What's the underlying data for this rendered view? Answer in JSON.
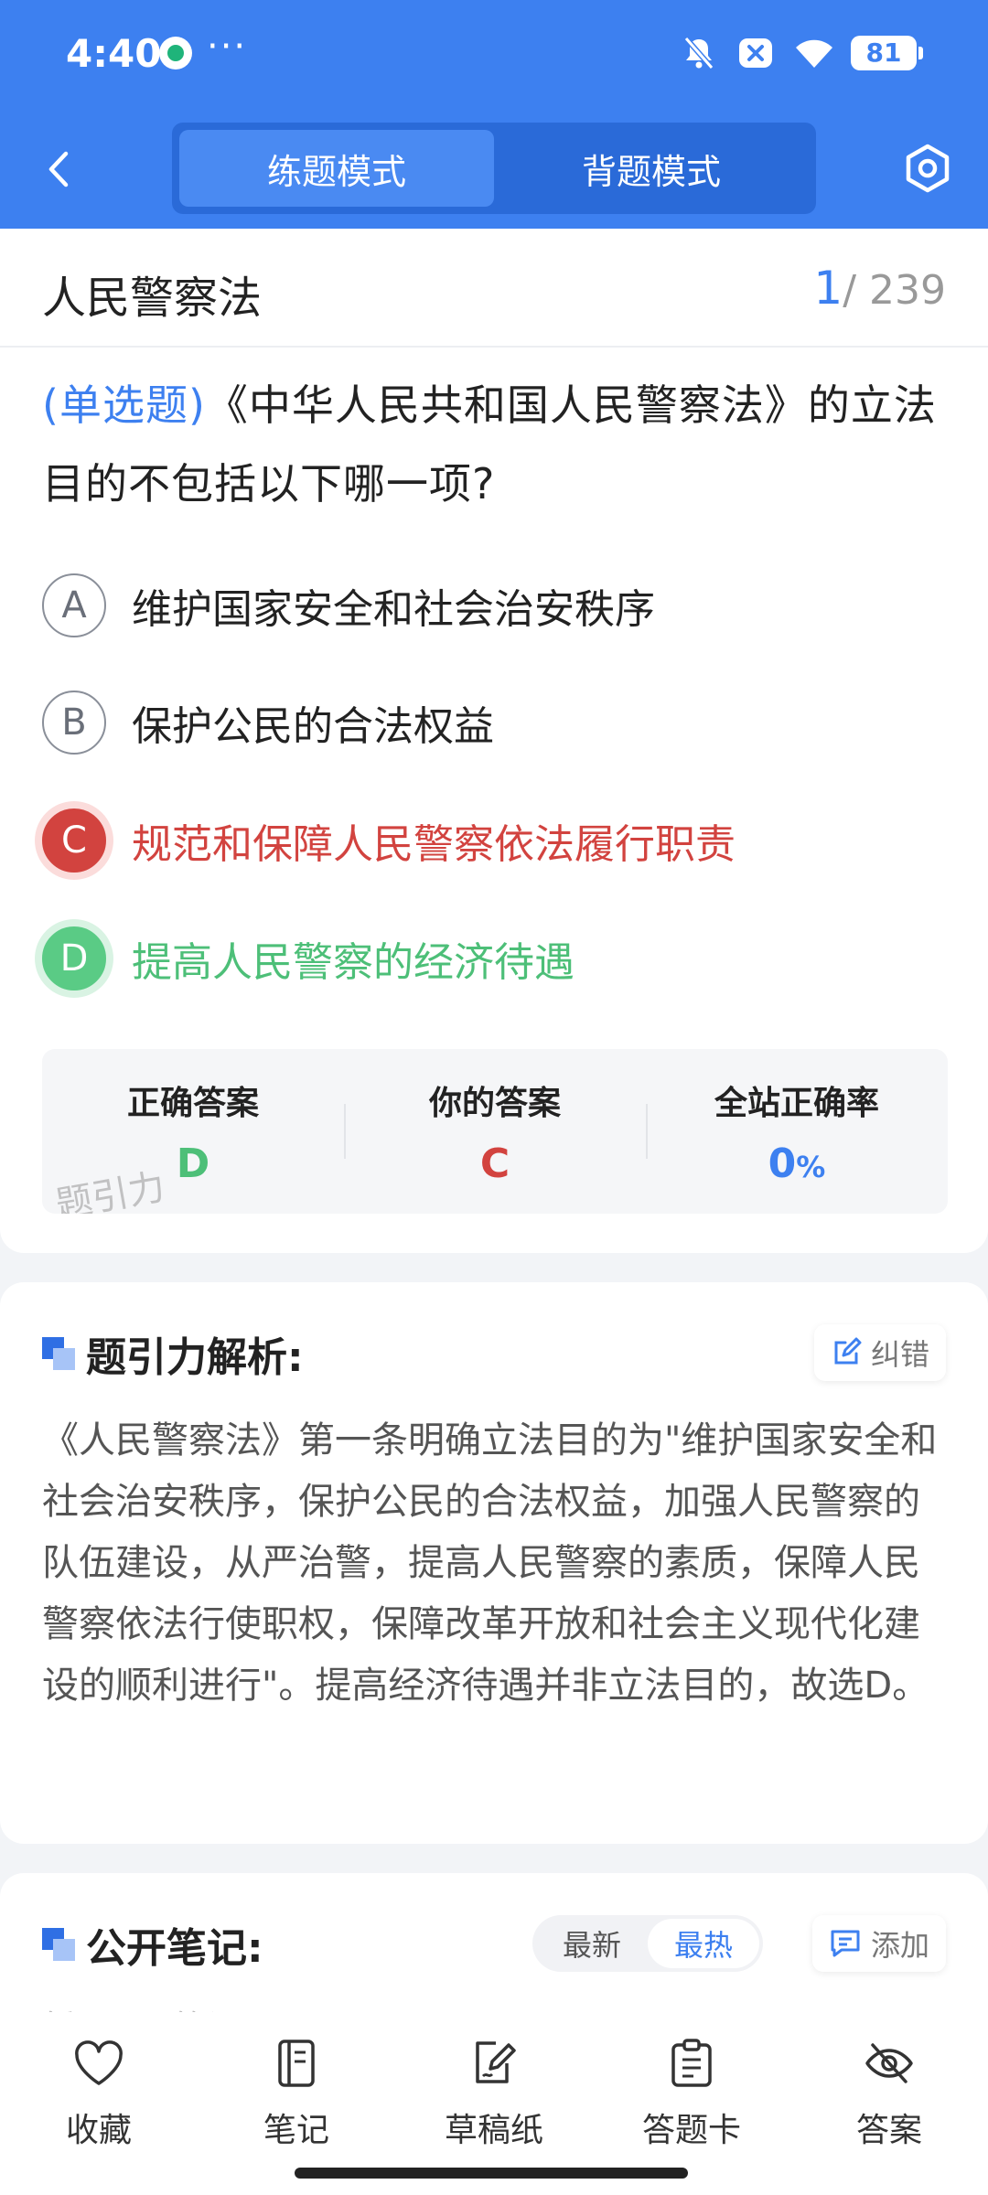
{
  "status_bar": {
    "time": "4:40",
    "more": "···",
    "battery": "81"
  },
  "nav": {
    "tabs": [
      "练题模式",
      "背题模式"
    ],
    "active_tab": 0
  },
  "header": {
    "chapter": "人民警察法",
    "current": "1",
    "total": "/ 239"
  },
  "question": {
    "type": "(单选题)",
    "text": "《中华人民共和国人民警察法》的立法目的不包括以下哪一项?"
  },
  "options": [
    {
      "letter": "A",
      "text": "维护国家安全和社会治安秩序",
      "state": "normal"
    },
    {
      "letter": "B",
      "text": "保护公民的合法权益",
      "state": "normal"
    },
    {
      "letter": "C",
      "text": "规范和保障人民警察依法履行职责",
      "state": "wrong"
    },
    {
      "letter": "D",
      "text": "提高人民警察的经济待遇",
      "state": "right"
    }
  ],
  "answer_summary": {
    "correct_label": "正确答案",
    "correct_value": "D",
    "yours_label": "你的答案",
    "yours_value": "C",
    "rate_label": "全站正确率",
    "rate_value": "0",
    "rate_unit": "%",
    "watermark": "题引力"
  },
  "analysis": {
    "title": "题引力解析:",
    "report_button": "纠错",
    "text": "《人民警察法》第一条明确立法目的为\"维护国家安全和社会治安秩序，保护公民的合法权益，加强人民警察的队伍建设，从严治警，提高人民警察的素质，保障人民警察依法行使职权，保障改革开放和社会主义现代化建设的顺利进行\"。提高经济待遇并非立法目的，故选D。"
  },
  "notes": {
    "title": "公开笔记:",
    "sort_options": [
      "最新",
      "最热"
    ],
    "active_sort": 1,
    "add_button": "添加",
    "empty_text": "暂无公开笔记"
  },
  "bottom_bar": {
    "items": [
      {
        "label": "收藏",
        "icon": "heart-icon"
      },
      {
        "label": "笔记",
        "icon": "notebook-icon"
      },
      {
        "label": "草稿纸",
        "icon": "draft-pen-icon"
      },
      {
        "label": "答题卡",
        "icon": "clipboard-icon"
      },
      {
        "label": "答案",
        "icon": "eye-off-icon"
      }
    ]
  },
  "colors": {
    "primary": "#3d80f0",
    "wrong": "#d2433f",
    "right": "#4dbf78"
  }
}
